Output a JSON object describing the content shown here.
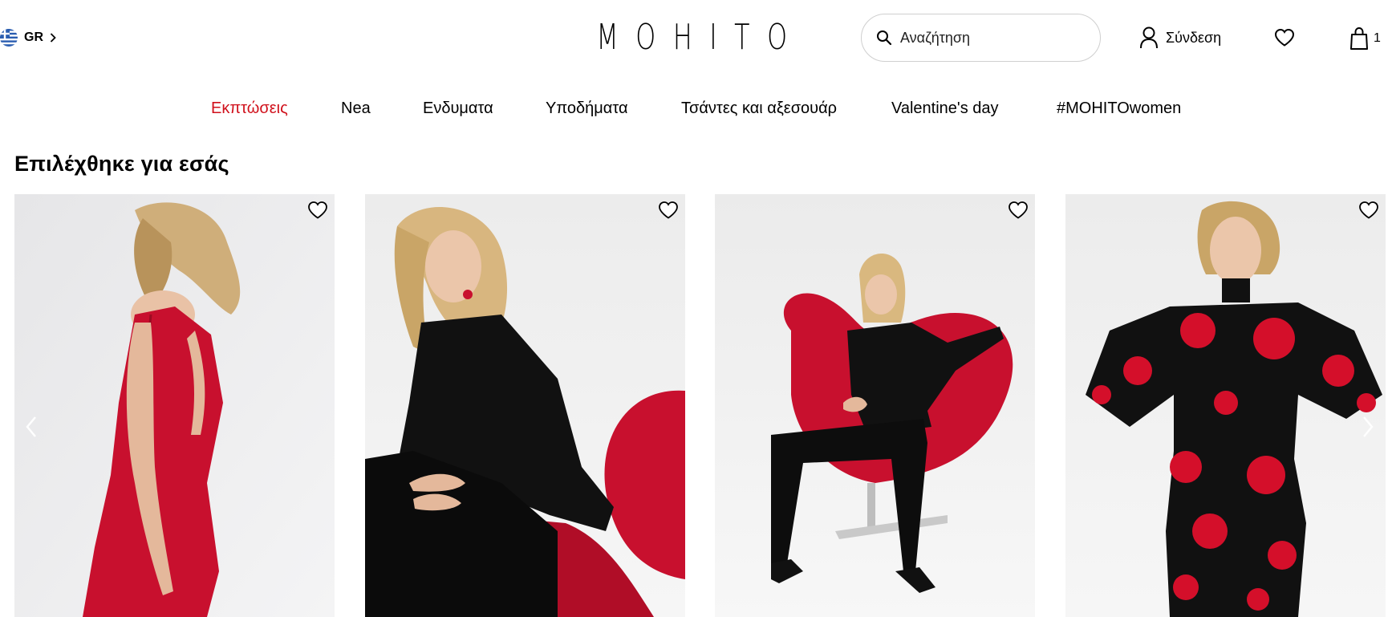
{
  "header": {
    "locale": {
      "label": "GR"
    },
    "logo": "MOHITO",
    "search": {
      "placeholder": "Αναζήτηση"
    },
    "login": {
      "label": "Σύνδεση"
    },
    "cart": {
      "count": "1"
    }
  },
  "nav": {
    "items": [
      {
        "label": "Εκπτώσεις"
      },
      {
        "label": "Nea"
      },
      {
        "label": "Ενδυματα"
      },
      {
        "label": "Υποδήματα"
      },
      {
        "label": "Τσάντες και αξεσουάρ"
      },
      {
        "label": "Valentine's day"
      },
      {
        "label": "#MOHITOwomen"
      }
    ]
  },
  "section": {
    "title": "Επιλέχθηκε για εσάς"
  },
  "icons": {
    "search": "search-icon",
    "user": "user-icon",
    "heart": "heart-icon",
    "bag": "shopping-bag-icon",
    "flag": "greece-flag-icon",
    "chevron": "chevron-right-icon",
    "prev": "arrow-left-icon",
    "next": "arrow-right-icon"
  },
  "colors": {
    "sale": "#d0101b",
    "accent_red": "#c8102e",
    "text": "#000000",
    "border": "#cfcfcf"
  }
}
